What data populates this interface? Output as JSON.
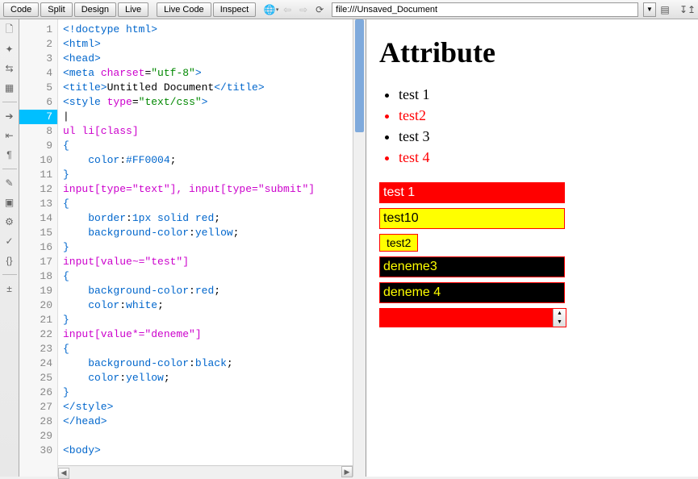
{
  "toolbar": {
    "code": "Code",
    "split": "Split",
    "design": "Design",
    "live": "Live",
    "livecode": "Live Code",
    "inspect": "Inspect",
    "address": "file:///Unsaved_Document"
  },
  "code_lines": [
    {
      "n": 1,
      "html": "<span class='t-tag'>&lt;!doctype html&gt;</span>"
    },
    {
      "n": 2,
      "html": "<span class='t-tag'>&lt;html&gt;</span>"
    },
    {
      "n": 3,
      "html": "<span class='t-tag'>&lt;head&gt;</span>"
    },
    {
      "n": 4,
      "html": "<span class='t-tag'>&lt;meta</span> <span class='t-attr'>charset</span>=<span class='t-str'>\"utf-8\"</span><span class='t-tag'>&gt;</span>"
    },
    {
      "n": 5,
      "html": "<span class='t-tag'>&lt;title&gt;</span>Untitled Document<span class='t-tag'>&lt;/title&gt;</span>"
    },
    {
      "n": 6,
      "html": "<span class='t-tag'>&lt;style</span> <span class='t-attr'>type</span>=<span class='t-str'>\"text/css\"</span><span class='t-tag'>&gt;</span>"
    },
    {
      "n": 7,
      "html": "|",
      "active": true
    },
    {
      "n": 8,
      "html": "<span class='t-sel'>ul li[class]</span>"
    },
    {
      "n": 9,
      "html": "<span class='t-punc'>{</span>"
    },
    {
      "n": 10,
      "html": "    <span class='t-prop'>color</span>:<span class='t-val'>#FF0004</span>;"
    },
    {
      "n": 11,
      "html": "<span class='t-punc'>}</span>"
    },
    {
      "n": 12,
      "html": "<span class='t-sel'>input[type=\"text\"], input[type=\"submit\"]</span>"
    },
    {
      "n": 13,
      "html": "<span class='t-punc'>{</span>"
    },
    {
      "n": 14,
      "html": "    <span class='t-prop'>border</span>:<span class='t-val'>1px solid red</span>;"
    },
    {
      "n": 15,
      "html": "    <span class='t-prop'>background-color</span>:<span class='t-val'>yellow</span>;"
    },
    {
      "n": 16,
      "html": "<span class='t-punc'>}</span>"
    },
    {
      "n": 17,
      "html": "<span class='t-sel'>input[value~=\"test\"]</span>"
    },
    {
      "n": 18,
      "html": "<span class='t-punc'>{</span>"
    },
    {
      "n": 19,
      "html": "    <span class='t-prop'>background-color</span>:<span class='t-val'>red</span>;"
    },
    {
      "n": 20,
      "html": "    <span class='t-prop'>color</span>:<span class='t-val'>white</span>;"
    },
    {
      "n": 21,
      "html": "<span class='t-punc'>}</span>"
    },
    {
      "n": 22,
      "html": "<span class='t-sel'>input[value*=\"deneme\"]</span>"
    },
    {
      "n": 23,
      "html": "<span class='t-punc'>{</span>"
    },
    {
      "n": 24,
      "html": "    <span class='t-prop'>background-color</span>:<span class='t-val'>black</span>;"
    },
    {
      "n": 25,
      "html": "    <span class='t-prop'>color</span>:<span class='t-val'>yellow</span>;"
    },
    {
      "n": 26,
      "html": "<span class='t-punc'>}</span>"
    },
    {
      "n": 27,
      "html": "<span class='t-tag'>&lt;/style&gt;</span>"
    },
    {
      "n": 28,
      "html": "<span class='t-tag'>&lt;/head&gt;</span>"
    },
    {
      "n": 29,
      "html": ""
    },
    {
      "n": 30,
      "html": "<span class='t-tag'>&lt;body&gt;</span>"
    }
  ],
  "preview": {
    "heading": "Attribute",
    "list": [
      {
        "text": "test 1",
        "red": false
      },
      {
        "text": "test2",
        "red": true
      },
      {
        "text": "test 3",
        "red": false
      },
      {
        "text": "test 4",
        "red": true
      }
    ],
    "inputs": [
      {
        "value": "test 1",
        "cls": "red"
      },
      {
        "value": "test10",
        "cls": ""
      },
      {
        "value": "test2",
        "cls": "",
        "btn": true
      },
      {
        "value": "deneme3",
        "cls": "black"
      },
      {
        "value": "deneme 4",
        "cls": "black"
      }
    ]
  }
}
